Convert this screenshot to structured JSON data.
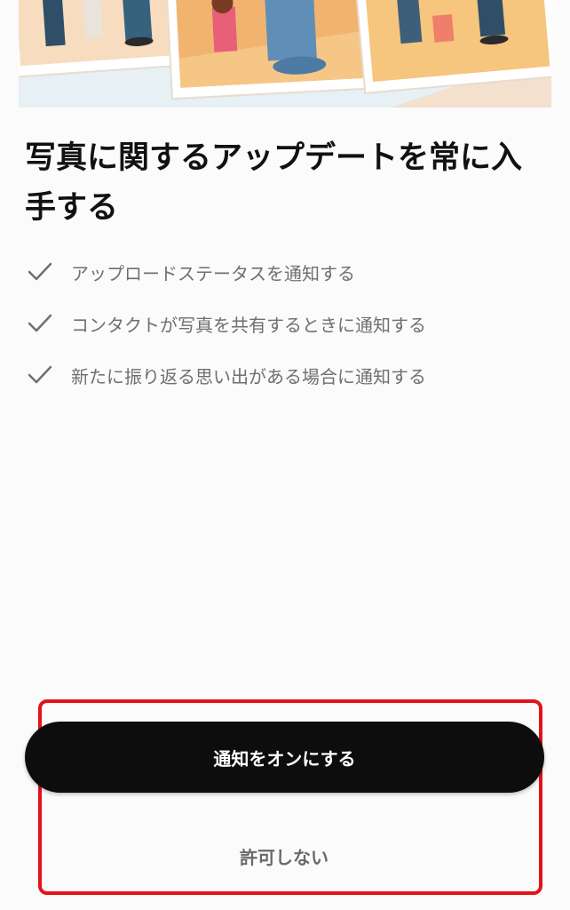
{
  "hero": {
    "image": "family-photos-illustration"
  },
  "headline": "写真に関するアップデートを常に入手する",
  "features": [
    {
      "icon": "checkmark-icon",
      "text": "アップロードステータスを通知する"
    },
    {
      "icon": "checkmark-icon",
      "text": "コンタクトが写真を共有するときに通知する"
    },
    {
      "icon": "checkmark-icon",
      "text": "新たに振り返る思い出がある場合に通知する"
    }
  ],
  "actions": {
    "primary_label": "通知をオンにする",
    "secondary_label": "許可しない"
  },
  "colors": {
    "background": "#fbfbfc",
    "primary_button": "#0d0d0d",
    "highlight": "#e3121b",
    "feature_text": "#6f6f72"
  }
}
